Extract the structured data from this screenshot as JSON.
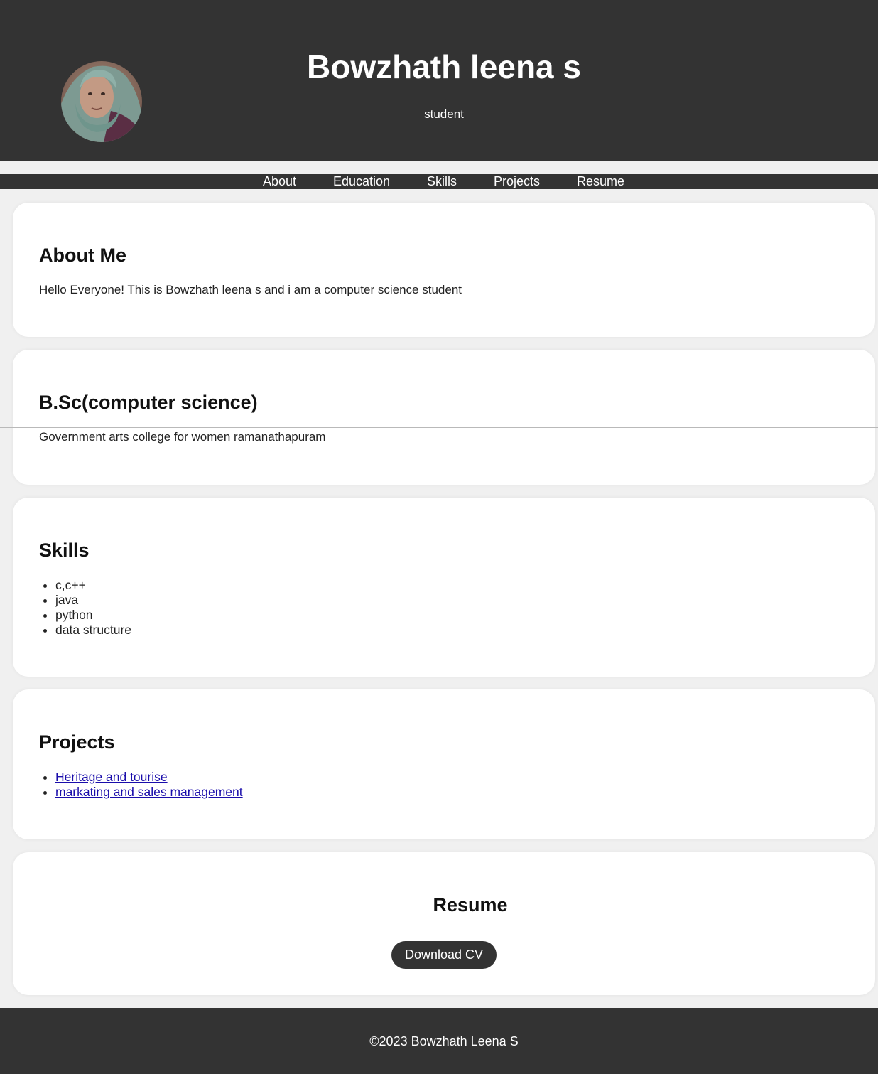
{
  "header": {
    "name": "Bowzhath leena s",
    "tagline": "student",
    "avatar_icon": "profile-photo"
  },
  "nav": {
    "items": [
      "About",
      "Education",
      "Skills",
      "Projects",
      "Resume"
    ]
  },
  "about": {
    "heading": "About Me",
    "text": "Hello Everyone! This is Bowzhath leena s and i am a computer science student"
  },
  "education": {
    "degree": "B.Sc(computer science)",
    "institution": "Government arts college for women ramanathapuram"
  },
  "skills": {
    "heading": "Skills",
    "items": [
      "c,c++",
      "java",
      "python",
      "data structure"
    ]
  },
  "projects": {
    "heading": "Projects",
    "items": [
      "Heritage and tourise",
      "markating and sales management"
    ]
  },
  "resume": {
    "heading": "Resume",
    "download_label": "Download CV"
  },
  "footer": {
    "text": "©2023 Bowzhath Leena S"
  },
  "colors": {
    "header_bg": "#333333",
    "page_bg": "#f0f0f0",
    "card_bg": "#ffffff",
    "link": "#1a0dab"
  }
}
